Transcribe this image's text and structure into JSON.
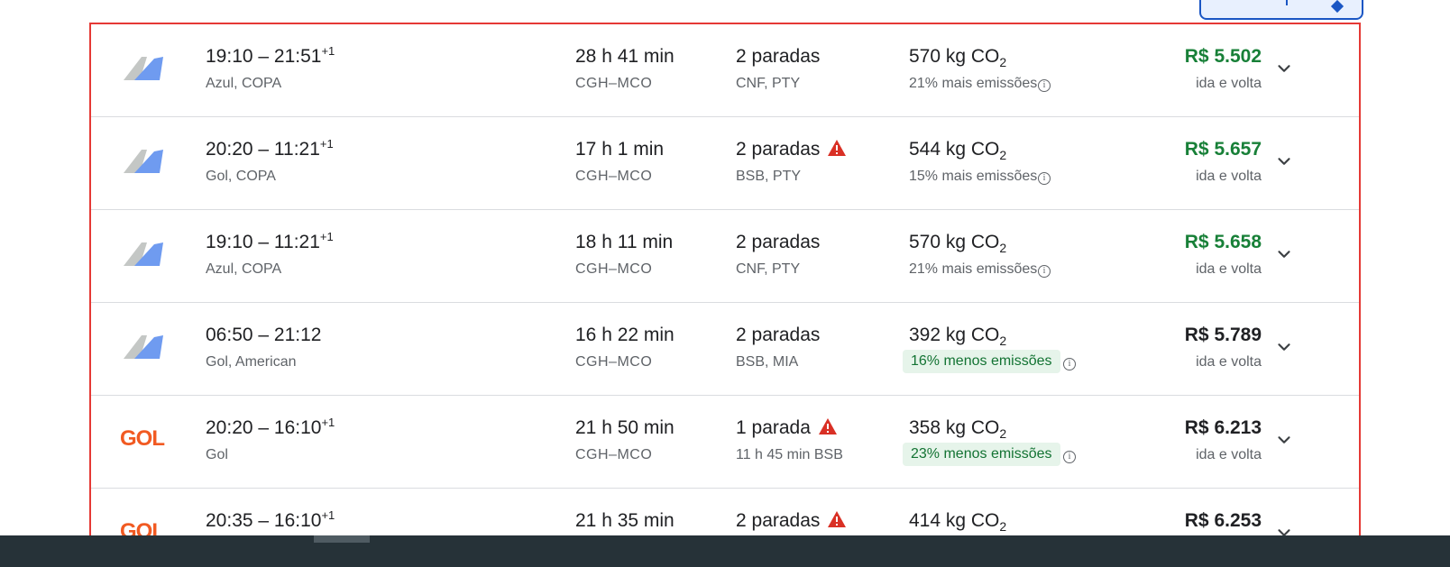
{
  "flights": [
    {
      "logo": "generic-tail",
      "times": "19:10 – 21:51",
      "plus": "+1",
      "airlines": "Azul, COPA",
      "duration": "28 h 41 min",
      "route": "CGH–MCO",
      "stops": "2 paradas",
      "warning": false,
      "stops_detail": "CNF, PTY",
      "co2_value": "570 kg CO",
      "co2_sub": "2",
      "emissions": "21% mais emissões",
      "emissions_good": false,
      "price": "R$ 5.502",
      "price_green": true,
      "price_sub": "ida e volta"
    },
    {
      "logo": "generic-tail",
      "times": "20:20 – 11:21",
      "plus": "+1",
      "airlines": "Gol, COPA",
      "duration": "17 h 1 min",
      "route": "CGH–MCO",
      "stops": "2 paradas",
      "warning": true,
      "stops_detail": "BSB, PTY",
      "co2_value": "544 kg CO",
      "co2_sub": "2",
      "emissions": "15% mais emissões",
      "emissions_good": false,
      "price": "R$ 5.657",
      "price_green": true,
      "price_sub": "ida e volta"
    },
    {
      "logo": "generic-tail",
      "times": "19:10 – 11:21",
      "plus": "+1",
      "airlines": "Azul, COPA",
      "duration": "18 h 11 min",
      "route": "CGH–MCO",
      "stops": "2 paradas",
      "warning": false,
      "stops_detail": "CNF, PTY",
      "co2_value": "570 kg CO",
      "co2_sub": "2",
      "emissions": "21% mais emissões",
      "emissions_good": false,
      "price": "R$ 5.658",
      "price_green": true,
      "price_sub": "ida e volta"
    },
    {
      "logo": "generic-tail",
      "times": "06:50 – 21:12",
      "plus": "",
      "airlines": "Gol, American",
      "duration": "16 h 22 min",
      "route": "CGH–MCO",
      "stops": "2 paradas",
      "warning": false,
      "stops_detail": "BSB, MIA",
      "co2_value": "392 kg CO",
      "co2_sub": "2",
      "emissions": "16% menos emissões",
      "emissions_good": true,
      "price": "R$ 5.789",
      "price_green": false,
      "price_sub": "ida e volta"
    },
    {
      "logo": "gol",
      "times": "20:20 – 16:10",
      "plus": "+1",
      "airlines": "Gol",
      "duration": "21 h 50 min",
      "route": "CGH–MCO",
      "stops": "1 parada",
      "warning": true,
      "stops_detail": "11 h 45 min BSB",
      "co2_value": "358 kg CO",
      "co2_sub": "2",
      "emissions": "23% menos emissões",
      "emissions_good": true,
      "price": "R$ 6.213",
      "price_green": false,
      "price_sub": "ida e volta"
    },
    {
      "logo": "gol",
      "times": "20:35 – 16:10",
      "plus": "+1",
      "airlines": "",
      "duration": "21 h 35 min",
      "route": "",
      "stops": "2 paradas",
      "warning": true,
      "stops_detail": "",
      "co2_value": "414 kg CO",
      "co2_sub": "2",
      "emissions": "",
      "emissions_good": false,
      "price": "R$ 6.253",
      "price_green": false,
      "price_sub": ""
    }
  ],
  "gol_logo_text": "GOL",
  "info_glyph": "i",
  "colors": {
    "price_green": "#188038",
    "warning_red": "#d93025",
    "good_bg": "#e6f4ea",
    "good_text": "#137333",
    "selection_border": "#e53935"
  }
}
